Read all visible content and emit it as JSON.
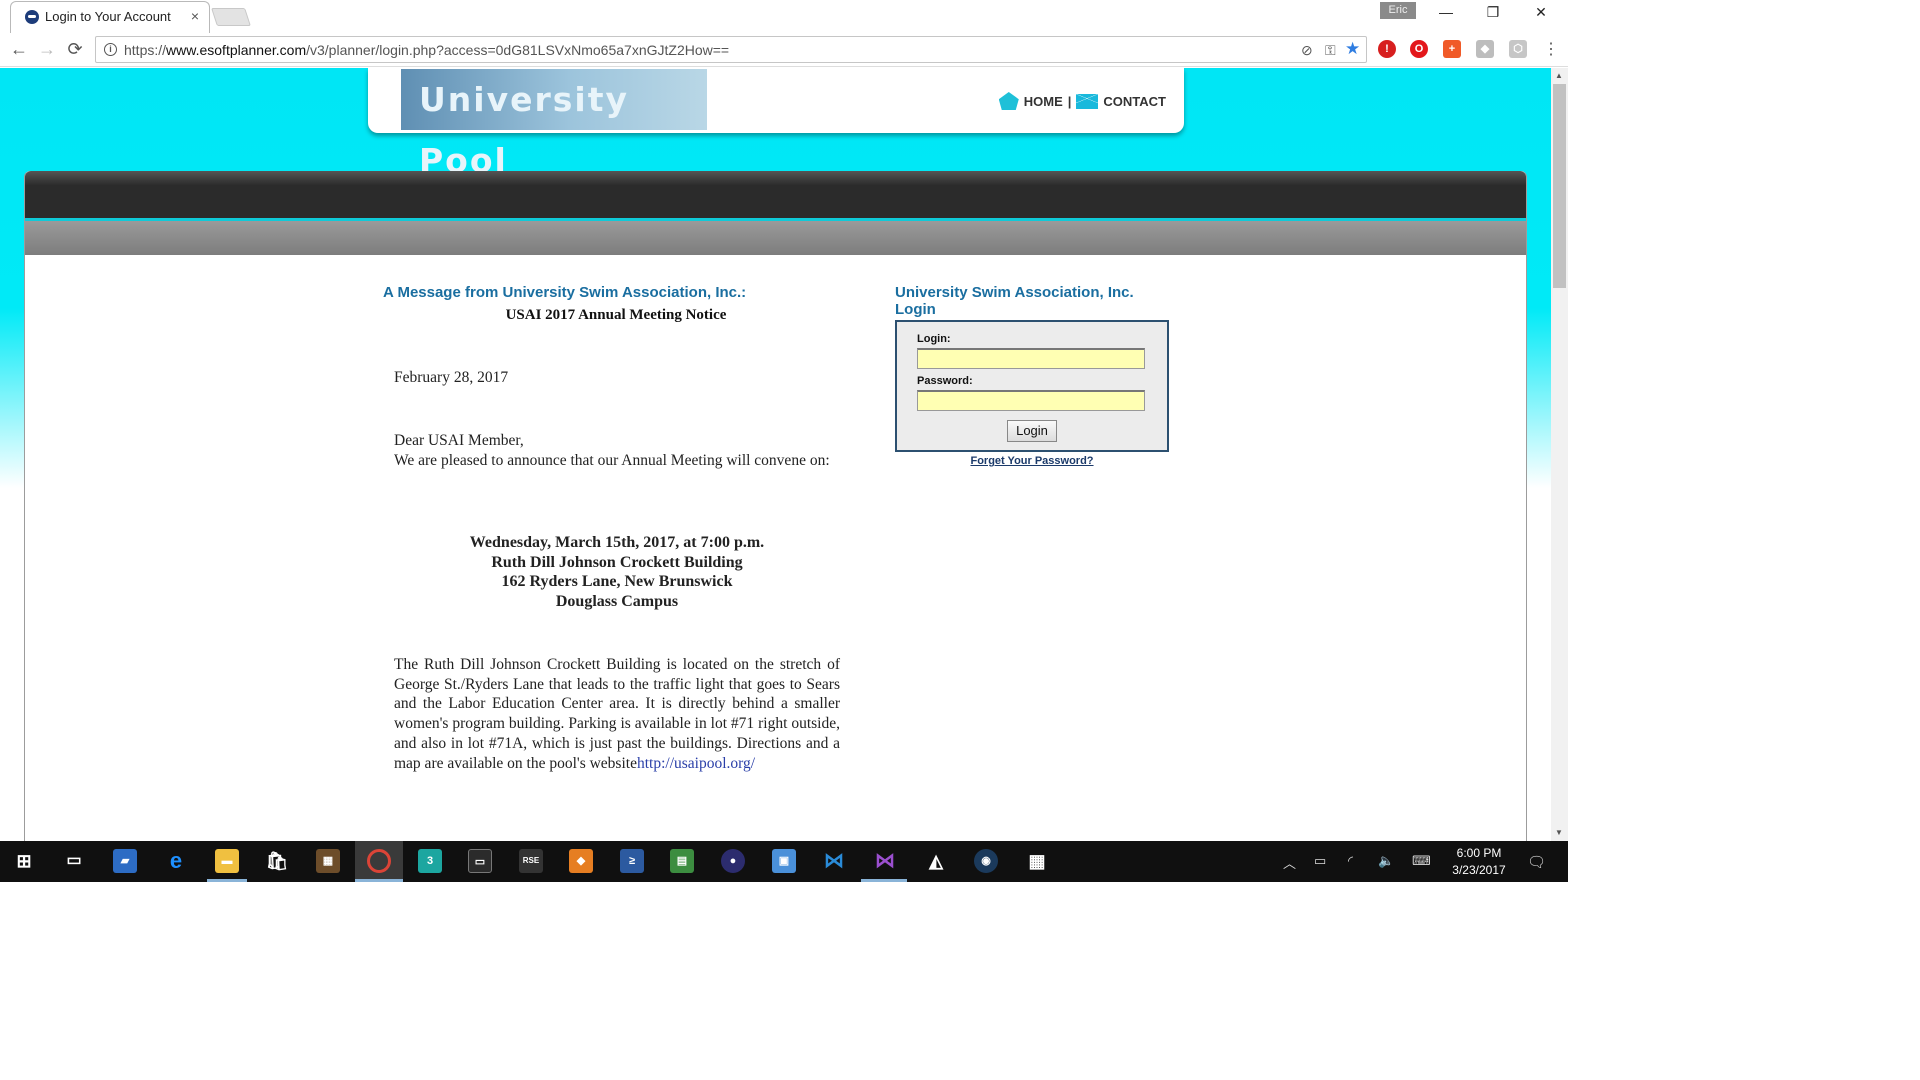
{
  "browser": {
    "tab_title": "Login to Your Account",
    "tab_close": "×",
    "profile": "Eric",
    "url_prefix": "https://",
    "url_host": "www.esoftplanner.com",
    "url_path": "/v3/planner/login.php?access=0dG81LSVxNmo65a7xnGJtZ2How==",
    "nav_back": "←",
    "nav_forward": "→",
    "nav_reload": "⟳",
    "win_minimize": "—",
    "win_restore": "❐",
    "win_close": "✕"
  },
  "site": {
    "logo_text": "University Pool",
    "nav_home": "HOME",
    "nav_sep": "|",
    "nav_contact": "CONTACT"
  },
  "message": {
    "heading": "A Message from University Swim Association, Inc.:",
    "notice_title": "USAI 2017 Annual Meeting Notice",
    "date": "February 28, 2017",
    "greeting": "Dear USAI Member,",
    "intro": "We are pleased to announce that our Annual Meeting will convene on:",
    "event_line1": "Wednesday, March 15th, 2017, at 7:00 p.m.",
    "event_line2": "Ruth Dill Johnson Crockett Building",
    "event_line3": "162 Ryders Lane, New Brunswick",
    "event_line4": "Douglass Campus",
    "directions": "The Ruth Dill Johnson Crockett Building is located on the stretch of George St./Ryders Lane that leads to the traffic light that goes to Sears and the Labor Education Center area. It is directly behind a smaller women's program building. Parking is available in lot #71 right outside, and also in lot #71A, which is just past the buildings. Directions and a map are available on the pool's website",
    "website_link": "http://usaipool.org/"
  },
  "login": {
    "title": "University Swim Association, Inc. Login",
    "login_label": "Login:",
    "login_value": "",
    "password_label": "Password:",
    "password_value": "",
    "button": "Login",
    "forgot_link": "Forget Your Password?"
  },
  "taskbar": {
    "time": "6:00 PM",
    "date": "3/23/2017"
  },
  "colors": {
    "page_bg": "#00e6f5",
    "heading_blue": "#1a6ea0",
    "input_bg": "#ffffb3"
  }
}
